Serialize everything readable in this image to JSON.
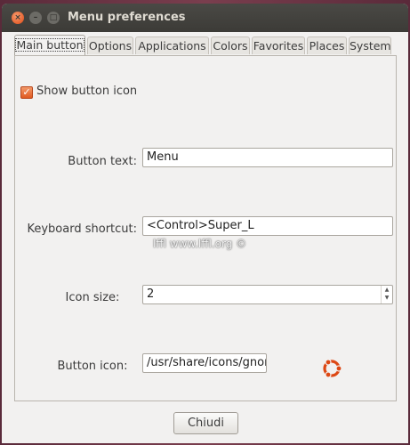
{
  "window": {
    "title": "Menu preferences"
  },
  "tabs": [
    {
      "label": "Main button"
    },
    {
      "label": "Options"
    },
    {
      "label": "Applications"
    },
    {
      "label": "Colors"
    },
    {
      "label": "Favorites"
    },
    {
      "label": "Places"
    },
    {
      "label": "System"
    }
  ],
  "main_button": {
    "show_icon": {
      "label": "Show button icon",
      "checked": true
    },
    "button_text": {
      "label": "Button text:",
      "value": "Menu"
    },
    "keyboard_shortcut": {
      "label": "Keyboard shortcut:",
      "value": "<Control>Super_L"
    },
    "icon_size": {
      "label": "Icon size:",
      "value": "2"
    },
    "button_icon": {
      "label": "Button icon:",
      "value": "/usr/share/icons/gnom",
      "icon": "ubuntu-logo-icon"
    }
  },
  "watermark": "lffl www.lffl.org ©",
  "footer": {
    "close_label": "Chiudi"
  },
  "colors": {
    "accent": "#e05a20",
    "ubuntu": "#dd4814"
  }
}
